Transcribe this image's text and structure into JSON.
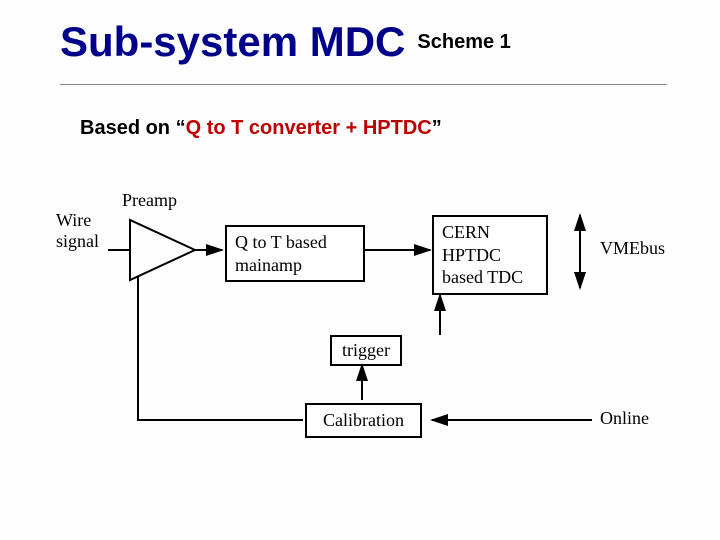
{
  "title": {
    "main": "Sub-system MDC",
    "sub": "Scheme 1"
  },
  "subtitle": {
    "prefix": "Based on “",
    "highlight": "Q to T converter + HPTDC",
    "suffix": "”"
  },
  "labels": {
    "wire_signal": "Wire\nsignal",
    "preamp": "Preamp",
    "mainamp": "Q to T based\nmainamp",
    "tdc": "CERN\nHPTDC\nbased TDC",
    "vmebus": "VMEbus",
    "trigger": "trigger",
    "calibration": "Calibration",
    "online": "Online"
  },
  "colors": {
    "title": "#000088",
    "accent": "#bb0000"
  }
}
